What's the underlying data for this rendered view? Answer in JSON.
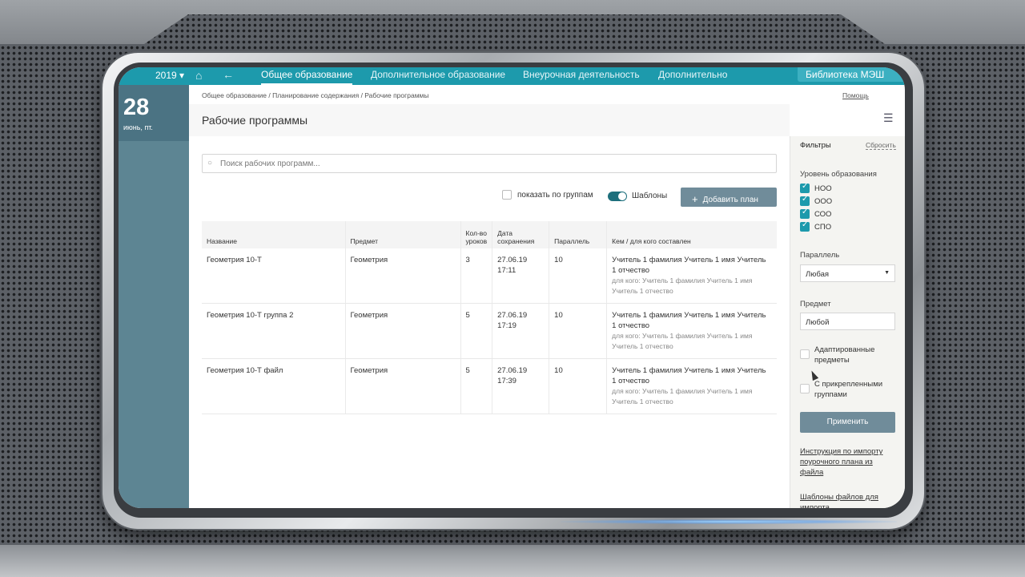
{
  "topbar": {
    "year": "2019 ▾",
    "tabs": [
      "Общее образование",
      "Дополнительное образование",
      "Внеурочная деятельность",
      "Дополнительно"
    ],
    "library_button": "Библиотека МЭШ"
  },
  "date": {
    "day": "28",
    "weekday": "июнь, пт."
  },
  "breadcrumb": "Общее образование / Планирование содержания / Рабочие программы",
  "help": "Помощь",
  "page_title": "Рабочие программы",
  "search": {
    "placeholder": "Поиск рабочих программ..."
  },
  "toolbar": {
    "group_label": "показать по группам",
    "templates_label": "Шаблоны",
    "add_label": "Добавить план"
  },
  "table": {
    "headers": [
      "Название",
      "Предмет",
      "Кол-во уроков",
      "Дата сохранения",
      "Параллель",
      "Кем / для кого составлен"
    ],
    "rows": [
      {
        "name": "Геометрия 10-Т",
        "subject": "Геометрия",
        "lessons": "3",
        "date": "27.06.19",
        "time": "17:11",
        "parallel": "10",
        "author": "Учитель 1 фамилия Учитель 1 имя Учитель 1 отчество",
        "for": "для кого: Учитель 1 фамилия Учитель 1 имя Учитель 1 отчество"
      },
      {
        "name": "Геометрия 10-Т группа 2",
        "subject": "Геометрия",
        "lessons": "5",
        "date": "27.06.19",
        "time": "17:19",
        "parallel": "10",
        "author": "Учитель 1 фамилия Учитель 1 имя Учитель 1 отчество",
        "for": "для кого: Учитель 1 фамилия Учитель 1 имя Учитель 1 отчество"
      },
      {
        "name": "Геометрия 10-Т файл",
        "subject": "Геометрия",
        "lessons": "5",
        "date": "27.06.19",
        "time": "17:39",
        "parallel": "10",
        "author": "Учитель 1 фамилия Учитель 1 имя Учитель 1 отчество",
        "for": "для кого: Учитель 1 фамилия Учитель 1 имя Учитель 1 отчество"
      }
    ]
  },
  "filters": {
    "title": "Фильтры",
    "reset": "Сбросить",
    "level_label": "Уровень образования",
    "levels": [
      "НОО",
      "ООО",
      "СОО",
      "СПО"
    ],
    "parallel_label": "Параллель",
    "parallel_value": "Любая",
    "subject_label": "Предмет",
    "subject_value": "Любой",
    "adapted": "Адаптированные предметы",
    "attached": "С прикрепленными группами",
    "apply": "Применить",
    "link1": "Инструкция по импорту поурочного плана из файла",
    "link2": "Шаблоны файлов для импорта"
  },
  "colors": {
    "accent": "#1d9aac",
    "button": "#708c9a",
    "sidebar": "#5d8593"
  }
}
